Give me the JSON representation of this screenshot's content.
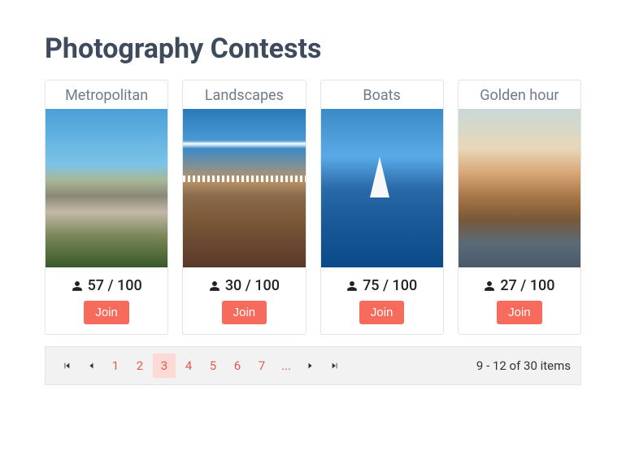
{
  "page_title": "Photography Contests",
  "cards": [
    {
      "title": "Metropolitan",
      "count": "57 / 100",
      "join": "Join"
    },
    {
      "title": "Landscapes",
      "count": "30 / 100",
      "join": "Join"
    },
    {
      "title": "Boats",
      "count": "75 / 100",
      "join": "Join"
    },
    {
      "title": "Golden hour",
      "count": "27 / 100",
      "join": "Join"
    }
  ],
  "pager": {
    "pages": [
      "1",
      "2",
      "3",
      "4",
      "5",
      "6",
      "7",
      "..."
    ],
    "selected_index": 2,
    "status": "9 - 12 of 30 items"
  }
}
